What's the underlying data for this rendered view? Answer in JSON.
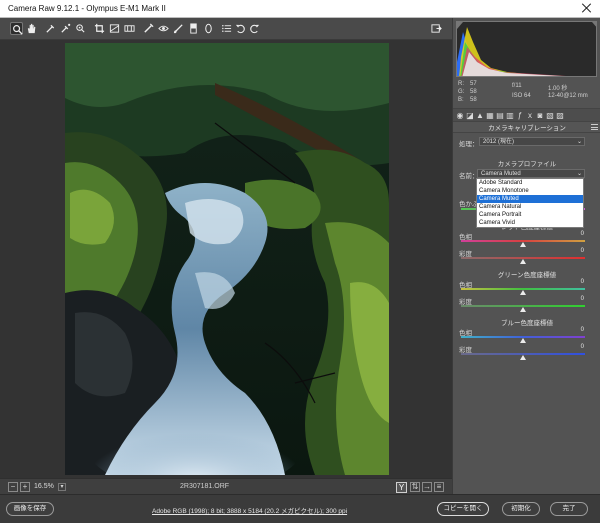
{
  "app": {
    "title": "Camera Raw 9.12.1  -  Olympus E-M1 Mark II"
  },
  "toolbar": {
    "tools": [
      "zoom-icon",
      "hand-icon",
      "white-balance-icon",
      "color-sampler-icon",
      "targeted-adjustment-icon",
      "crop-icon",
      "straighten-icon",
      "transform-icon",
      "spot-removal-icon",
      "red-eye-icon",
      "adjustment-brush-icon",
      "graduated-filter-icon",
      "radial-filter-icon",
      "preferences-icon",
      "rotate-left-icon",
      "rotate-right-icon"
    ],
    "export_icon": "export-icon"
  },
  "status": {
    "zoom": "16.5%",
    "filename": "2R307181.ORF",
    "y_button": "Y"
  },
  "readout": {
    "r_label": "R:",
    "r_value": "57",
    "g_label": "G:",
    "g_value": "58",
    "b_label": "B:",
    "b_value": "58",
    "aperture": "f/11",
    "shutter": "1.00 秒",
    "iso": "ISO 64",
    "focal": "12-40@12 mm"
  },
  "panel": {
    "header": "カメラキャリブレーション",
    "process_label": "処理：",
    "process_value": "2012 (現在)",
    "profile_section": "カメラプロファイル",
    "name_label": "名前：",
    "name_value": "Camera Muted",
    "profile_options": [
      "Adobe Standard",
      "Camera Monotone",
      "Camera Muted",
      "Camera Natural",
      "Camera Portrait",
      "Camera Vivid"
    ],
    "selected_option": "Camera Muted",
    "shadow_label": "色かぶ",
    "shadow_value": "0",
    "red_section": "レッド色度座標値",
    "green_section": "グリーン色度座標値",
    "blue_section": "ブルー色度座標値",
    "hue_label": "色相",
    "sat_label": "彩度",
    "red_hue": "0",
    "red_sat": "0",
    "green_hue": "0",
    "green_sat": "0",
    "blue_hue": "0",
    "blue_sat": "0"
  },
  "bottom": {
    "save_label": "画像を保存",
    "workflow_link": "Adobe RGB (1998); 8 bit; 3888 x 5184 (20.2 メガピクセル); 300 ppi",
    "open_copy_label": "コピーを開く",
    "reset_label": "初期化",
    "done_label": "完了"
  },
  "colors": {
    "selection": "#1e70d6",
    "panel_bg": "#535353",
    "preview_bg": "#333333"
  }
}
